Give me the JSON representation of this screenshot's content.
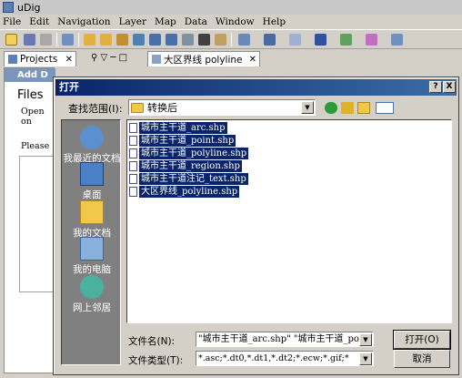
{
  "app": {
    "title": "uDig"
  },
  "menu": [
    "File",
    "Edit",
    "Navigation",
    "Layer",
    "Map",
    "Data",
    "Window",
    "Help"
  ],
  "view_tabs": {
    "projects": "Projects",
    "map": "大区界线 polyline"
  },
  "left_panel": {
    "add_label": "Add D",
    "files_heading": "Files",
    "open_on": "Open on",
    "please": "Please"
  },
  "dialog": {
    "title": "打开",
    "help_button": "?",
    "close_button": "X",
    "look_in_label": "查找范围(I):",
    "look_in_value": "转换后",
    "places": [
      "我最近的文档",
      "桌面",
      "我的文档",
      "我的电脑",
      "网上邻居"
    ],
    "files": [
      "城市主干道_arc.shp",
      "城市主干道_point.shp",
      "城市主干道_polyline.shp",
      "城市主干道_region.shp",
      "城市主干道注记_text.shp",
      "大区界线_polyline.shp"
    ],
    "file_name_label": "文件名(N):",
    "file_name_value": "\"城市主干道_arc.shp\" \"城市主干道_point",
    "file_type_label": "文件类型(T):",
    "file_type_value": "*.asc;*.dt0,*.dt1,*.dt2;*.ecw;*.gif;*",
    "open_button": "打开(O)",
    "cancel_button": "取消"
  },
  "colors": {
    "title_gradient_start": "#0a246a",
    "title_gradient_end": "#3a6ea5",
    "selection": "#0a246a",
    "places_bar": "#808080",
    "chrome": "#d4d0c8"
  }
}
